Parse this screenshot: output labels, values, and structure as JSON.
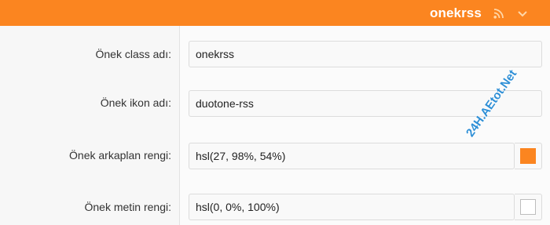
{
  "header": {
    "title": "onekrss",
    "icons": [
      "rss-icon",
      "chevron-down-icon"
    ]
  },
  "form": {
    "rows": [
      {
        "label": "Önek class adı:",
        "value": "onekrss"
      },
      {
        "label": "Önek ikon adı:",
        "value": "duotone-rss"
      },
      {
        "label": "Önek arkaplan rengi:",
        "value": "hsl(27, 98%, 54%)",
        "swatch_color": "#fb8520"
      },
      {
        "label": "Önek metin rengi:",
        "value": "hsl(0, 0%, 100%)",
        "swatch_color": "#ffffff"
      }
    ]
  },
  "colors": {
    "accent": "#fb8520",
    "header_text": "#ffffff"
  },
  "watermark": {
    "text": "24H.AEtot.Net"
  }
}
